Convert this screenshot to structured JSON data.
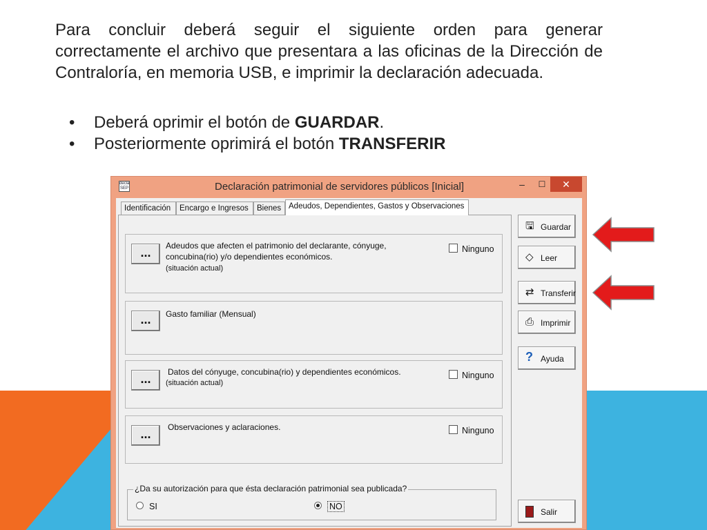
{
  "slide": {
    "intro": "Para concluir deberá seguir el siguiente orden para generar correctamente el archivo que presentara a las oficinas de la Dirección de Contraloría, en memoria USB, e imprimir la declaración adecuada.",
    "bullets": [
      {
        "text": "Deberá oprimir el botón de ",
        "bold": "GUARDAR",
        "after": "."
      },
      {
        "text": "Posteriormente oprimirá el botón ",
        "bold": "TRANSFERIR",
        "after": ""
      }
    ],
    "bullet_glyph": "•"
  },
  "window": {
    "title": "Declaración patrimonial de servidores públicos [Inicial]",
    "icon_text": "declara SEP",
    "controls": {
      "minimize": "–",
      "maximize": "☐",
      "close": "✕"
    },
    "tabs": [
      {
        "label": "Identificación",
        "active": false
      },
      {
        "label": "Encargo e Ingresos",
        "active": false
      },
      {
        "label": "Bienes",
        "active": false
      },
      {
        "label": "Adeudos, Dependientes, Gastos y Observaciones",
        "active": true
      }
    ],
    "groups": [
      {
        "button": "...",
        "text_line1": "Adeudos que afecten el patrimonio del declarante, cónyuge,",
        "text_line2": "concubina(rio) y/o dependientes económicos.",
        "sub": "(situación actual)",
        "checkbox": "Ninguno"
      },
      {
        "button": "...",
        "text_line1": "Gasto familiar (Mensual)"
      },
      {
        "button": "...",
        "text_line1": "Datos del cónyuge, concubina(rio) y dependientes económicos.",
        "sub": "(situación actual)",
        "checkbox": "Ninguno"
      },
      {
        "button": "...",
        "text_line1": "Observaciones y aclaraciones.",
        "checkbox": "Ninguno"
      }
    ],
    "authorization": {
      "question": "¿Da su autorización para que ésta declaración patrimonial sea publicada?",
      "options": [
        {
          "label": "SI",
          "selected": false
        },
        {
          "label": "NO",
          "selected": true
        }
      ]
    },
    "side_buttons": [
      {
        "label": "Guardar",
        "icon": "save-icon"
      },
      {
        "label": "Leer",
        "icon": "read-icon"
      },
      {
        "label": "Transferir",
        "icon": "transfer-icon"
      },
      {
        "label": "Imprimir",
        "icon": "printer-icon"
      },
      {
        "label": "Ayuda",
        "icon": "help-icon"
      },
      {
        "label": "Salir",
        "icon": "exit-icon"
      }
    ]
  },
  "colors": {
    "accent_orange": "#f26b21",
    "accent_blue": "#3db3e0",
    "window_frame": "#f0a282",
    "close_button": "#c8482f",
    "arrow_red": "#e31b1b"
  }
}
